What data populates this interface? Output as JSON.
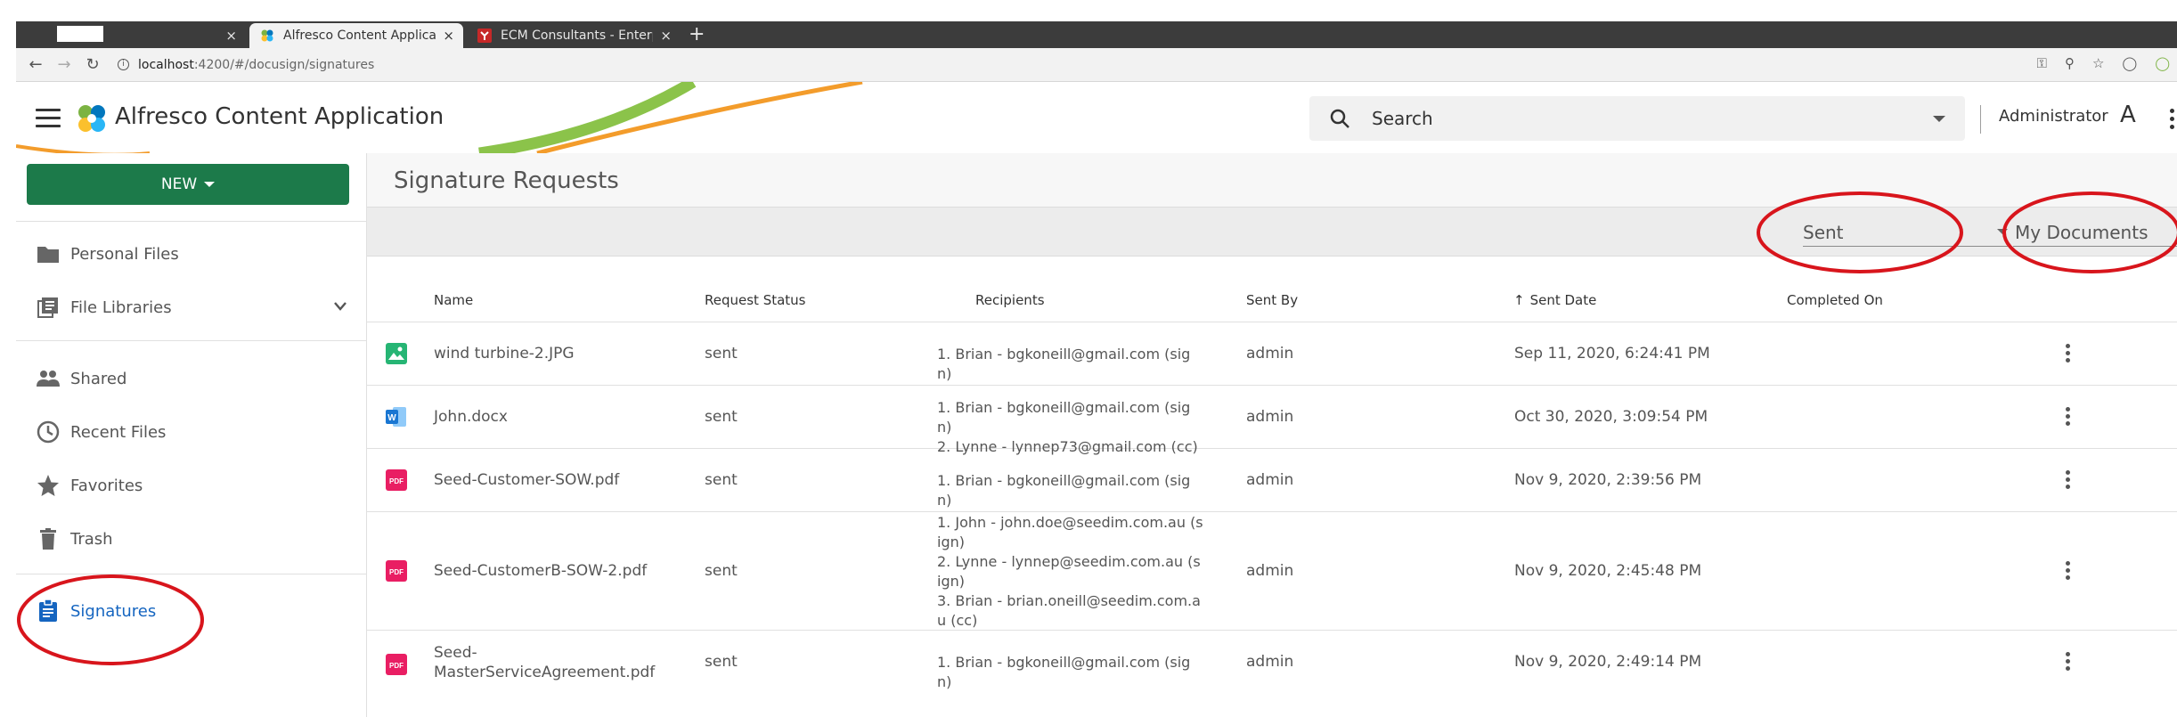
{
  "browser": {
    "tabs": [
      {
        "title": "",
        "close": "×"
      },
      {
        "title": "Alfresco Content Applicat",
        "close": "×"
      },
      {
        "title": "ECM Consultants - Enterp",
        "close": "×"
      }
    ],
    "new_tab": "+",
    "url_host": "localhost",
    "url_path": ":4200/#/docusign/signatures"
  },
  "header": {
    "app_title": "Alfresco Content Application",
    "search_placeholder": "Search",
    "user_name": "Administrator",
    "avatar_initial": "A"
  },
  "sidebar": {
    "new_button": "NEW",
    "items": [
      {
        "label": "Personal Files",
        "icon": "folder-icon"
      },
      {
        "label": "File Libraries",
        "icon": "library-icon"
      },
      {
        "label": "Shared",
        "icon": "people-icon"
      },
      {
        "label": "Recent Files",
        "icon": "clock-icon"
      },
      {
        "label": "Favorites",
        "icon": "star-icon"
      },
      {
        "label": "Trash",
        "icon": "trash-icon"
      },
      {
        "label": "Signatures",
        "icon": "clipboard-icon",
        "active": true
      }
    ]
  },
  "main": {
    "page_title": "Signature Requests",
    "filters": {
      "status": "Sent",
      "scope": "My Documents"
    },
    "columns": [
      "Name",
      "Request Status",
      "Recipients",
      "Sent By",
      "Sent Date",
      "Completed On"
    ],
    "rows": [
      {
        "name": "wind turbine-2.JPG",
        "type": "image",
        "status": "sent",
        "recipients": [
          "1. Brian - bgkoneill@gmail.com (sign)"
        ],
        "sent_by": "admin",
        "sent_date": "Sep 11, 2020, 6:24:41 PM",
        "completed_on": ""
      },
      {
        "name": "John.docx",
        "type": "word",
        "status": "sent",
        "recipients": [
          "1. Brian - bgkoneill@gmail.com (sign)",
          "2. Lynne - lynnep73@gmail.com (cc)"
        ],
        "sent_by": "admin",
        "sent_date": "Oct 30, 2020, 3:09:54 PM",
        "completed_on": ""
      },
      {
        "name": "Seed-Customer-SOW.pdf",
        "type": "pdf",
        "status": "sent",
        "recipients": [
          "1. Brian - bgkoneill@gmail.com (sign)"
        ],
        "sent_by": "admin",
        "sent_date": "Nov 9, 2020, 2:39:56 PM",
        "completed_on": ""
      },
      {
        "name": "Seed-CustomerB-SOW-2.pdf",
        "type": "pdf",
        "status": "sent",
        "recipients": [
          "1. John - john.doe@seedim.com.au (sign)",
          "2. Lynne - lynnep@seedim.com.au (sign)",
          "3. Brian - brian.oneill@seedim.com.au (cc)"
        ],
        "sent_by": "admin",
        "sent_date": "Nov 9, 2020, 2:45:48 PM",
        "completed_on": ""
      },
      {
        "name_lines": [
          "Seed-",
          "MasterServiceAgreement.pdf"
        ],
        "type": "pdf",
        "status": "sent",
        "recipients": [
          "1. Brian - bgkoneill@gmail.com (sign)"
        ],
        "sent_by": "admin",
        "sent_date": "Nov 9, 2020, 2:49:14 PM",
        "completed_on": ""
      }
    ]
  },
  "colors": {
    "primary_green": "#1c7a4a",
    "active_blue": "#1565c0",
    "pdf_red": "#e91e63",
    "annotation_red": "#d8151c"
  }
}
